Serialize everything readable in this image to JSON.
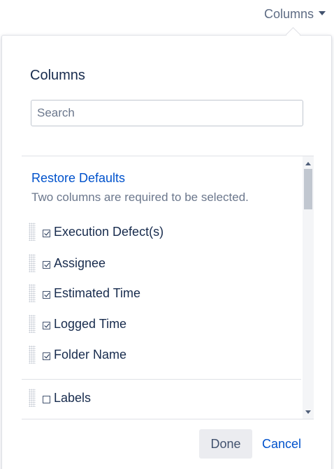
{
  "trigger": {
    "label": "Columns",
    "icon": "caret-down-icon"
  },
  "popover": {
    "title": "Columns",
    "search_placeholder": "Search",
    "search_value": "",
    "restore_label": "Restore Defaults",
    "hint": "Two columns are required to be selected.",
    "columns": [
      {
        "label": "Execution Defect(s)",
        "checked": true
      },
      {
        "label": "Assignee",
        "checked": true
      },
      {
        "label": "Estimated Time",
        "checked": true
      },
      {
        "label": "Logged Time",
        "checked": true
      },
      {
        "label": "Folder Name",
        "checked": true
      },
      {
        "label": "Labels",
        "checked": false
      }
    ],
    "done_label": "Done",
    "cancel_label": "Cancel"
  },
  "colors": {
    "link": "#0052cc",
    "text": "#172b4d",
    "muted": "#6b778c",
    "border": "#dfe1e6"
  }
}
